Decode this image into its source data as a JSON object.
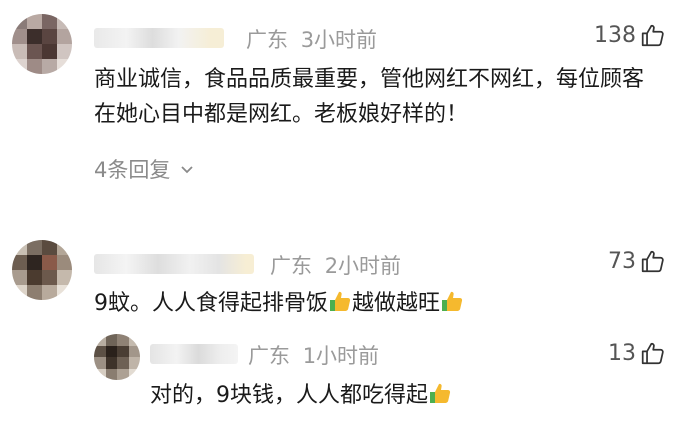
{
  "comments": [
    {
      "username": "",
      "region": "广东",
      "time": "3小时前",
      "likes": "138",
      "text": "商业诚信，食品品质最重要，管他网红不网红，每位顾客在她心目中都是网红。老板娘好样的！",
      "replies_label": "4条回复"
    },
    {
      "username": "",
      "region": "广东",
      "time": "2小时前",
      "likes": "73",
      "text_part1": "9蚊。人人食得起排骨饭",
      "text_part2": "越做越旺",
      "emoji": "thumbs-up-emoji"
    }
  ],
  "reply": {
    "username": "",
    "region": "广东",
    "time": "1小时前",
    "likes": "13",
    "text": "对的，9块钱，人人都吃得起",
    "emoji": "thumbs-up-emoji"
  },
  "colors": {
    "meta": "#9a9a9a",
    "text": "#1a1a1a",
    "emoji_yellow": "#f5b92e",
    "emoji_green": "#4caf50"
  }
}
